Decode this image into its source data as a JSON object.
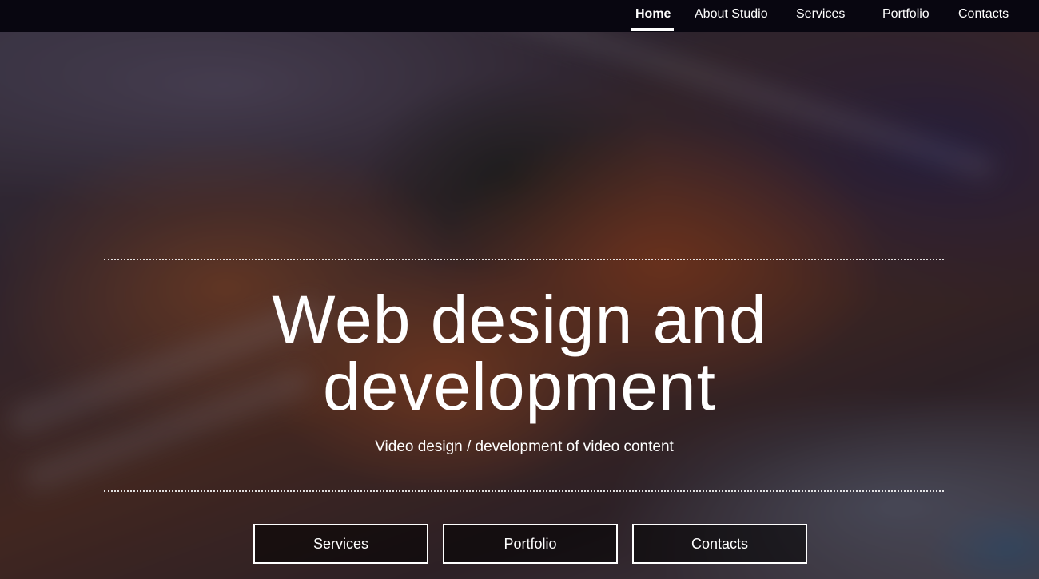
{
  "nav": {
    "items": [
      {
        "label": "Home",
        "active": true
      },
      {
        "label": "About Studio",
        "active": false
      },
      {
        "label": "Services",
        "active": false
      },
      {
        "label": "Portfolio",
        "active": false
      },
      {
        "label": "Contacts",
        "active": false
      }
    ]
  },
  "hero": {
    "title_line1": "Web design and",
    "title_line2": "development",
    "subtitle": "Video design / development of video content",
    "buttons": [
      {
        "label": "Services"
      },
      {
        "label": "Portfolio"
      },
      {
        "label": "Contacts"
      }
    ]
  },
  "colors": {
    "navbar_bg": "#080610",
    "text": "#ffffff",
    "button_bg": "rgba(0,0,0,0.55)"
  }
}
